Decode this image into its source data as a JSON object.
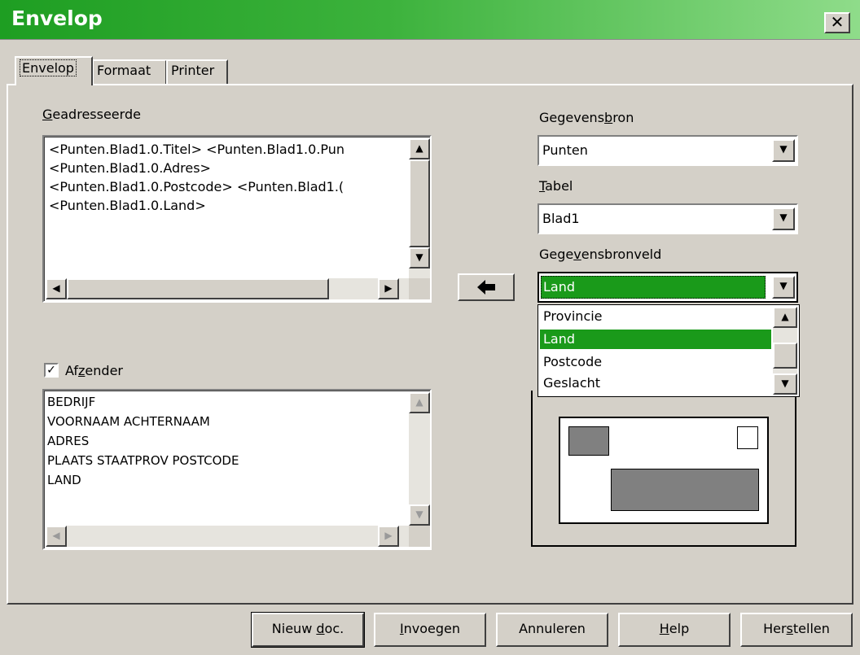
{
  "window": {
    "title": "Envelop",
    "close_glyph": "✕"
  },
  "tabs": [
    {
      "label": "Envelop",
      "active": true
    },
    {
      "label": "Formaat",
      "active": false
    },
    {
      "label": "Printer",
      "active": false
    }
  ],
  "addressee": {
    "label_pre": "",
    "label_accel": "G",
    "label_post": "eadresseerde",
    "lines": [
      "<Punten.Blad1.0.Titel> <Punten.Blad1.0.Pun",
      "<Punten.Blad1.0.Adres>",
      "<Punten.Blad1.0.Postcode> <Punten.Blad1.(",
      "<Punten.Blad1.0.Land>"
    ]
  },
  "sender": {
    "checked": true,
    "check_glyph": "✓",
    "label_pre": "Af",
    "label_accel": "z",
    "label_post": "ender",
    "lines": [
      "BEDRIJF",
      "VOORNAAM ACHTERNAAM",
      "ADRES",
      "PLAATS STAATPROV POSTCODE",
      "LAND"
    ]
  },
  "datasource": {
    "label_pre": "Gegevens",
    "label_accel": "b",
    "label_post": "ron",
    "value": "Punten"
  },
  "table": {
    "label_pre": "",
    "label_accel": "T",
    "label_post": "abel",
    "value": "Blad1"
  },
  "datafield": {
    "label_pre": "Gege",
    "label_accel": "v",
    "label_post": "ensbronveld",
    "value": "Land",
    "options": [
      "Provincie",
      "Land",
      "Postcode",
      "Geslacht"
    ],
    "highlighted": "Land"
  },
  "insert_arrow_glyph": "🡄",
  "buttons": {
    "new_doc": {
      "pre": "Nieuw ",
      "accel": "d",
      "post": "oc."
    },
    "insert": {
      "pre": "",
      "accel": "I",
      "post": "nvoegen"
    },
    "cancel": {
      "pre": "Annuleren",
      "accel": "",
      "post": ""
    },
    "help": {
      "pre": "",
      "accel": "H",
      "post": "elp"
    },
    "reset": {
      "pre": "Her",
      "accel": "s",
      "post": "tellen"
    }
  },
  "colors": {
    "titlebar_start": "#1e9e22",
    "titlebar_end": "#8fdc8a",
    "selection": "#1a9a1a",
    "dialog_bg": "#d4d0c8"
  }
}
